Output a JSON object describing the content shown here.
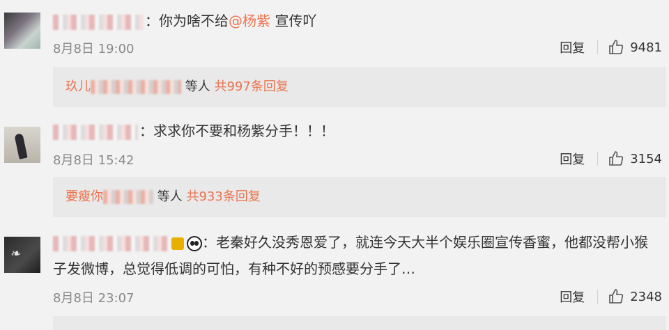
{
  "comments": [
    {
      "text_prefix": "：你为啥不给",
      "mention": "@杨紫",
      "text_suffix": " 宣传吖",
      "date": "8月8日 19:00",
      "reply_label": "回复",
      "likes": "9481",
      "reply_summary": {
        "name_prefix": "玖儿",
        "name_suffix": "等人",
        "count_text": "共997条回复"
      }
    },
    {
      "text": "：求求你不要和杨紫分手！！！",
      "date": "8月8日 15:42",
      "reply_label": "回复",
      "likes": "3154",
      "reply_summary": {
        "name_prefix": "要瘦你",
        "name_suffix": "等人",
        "count_text": "共933条回复"
      }
    },
    {
      "text_line1": "：老秦好久没秀恩爱了，就连今天大半个娱乐圈宣传香蜜，他都没帮小猴",
      "text_line2": "子发微博，总觉得低调的可怕，有种不好的预感要分手了…",
      "date": "8月8日 23:07",
      "reply_label": "回复",
      "likes": "2348"
    }
  ],
  "colors": {
    "link": "#eb7350",
    "muted": "#888888",
    "background": "#f2f2f2"
  },
  "icons": {
    "like": "thumbs-up-icon"
  }
}
